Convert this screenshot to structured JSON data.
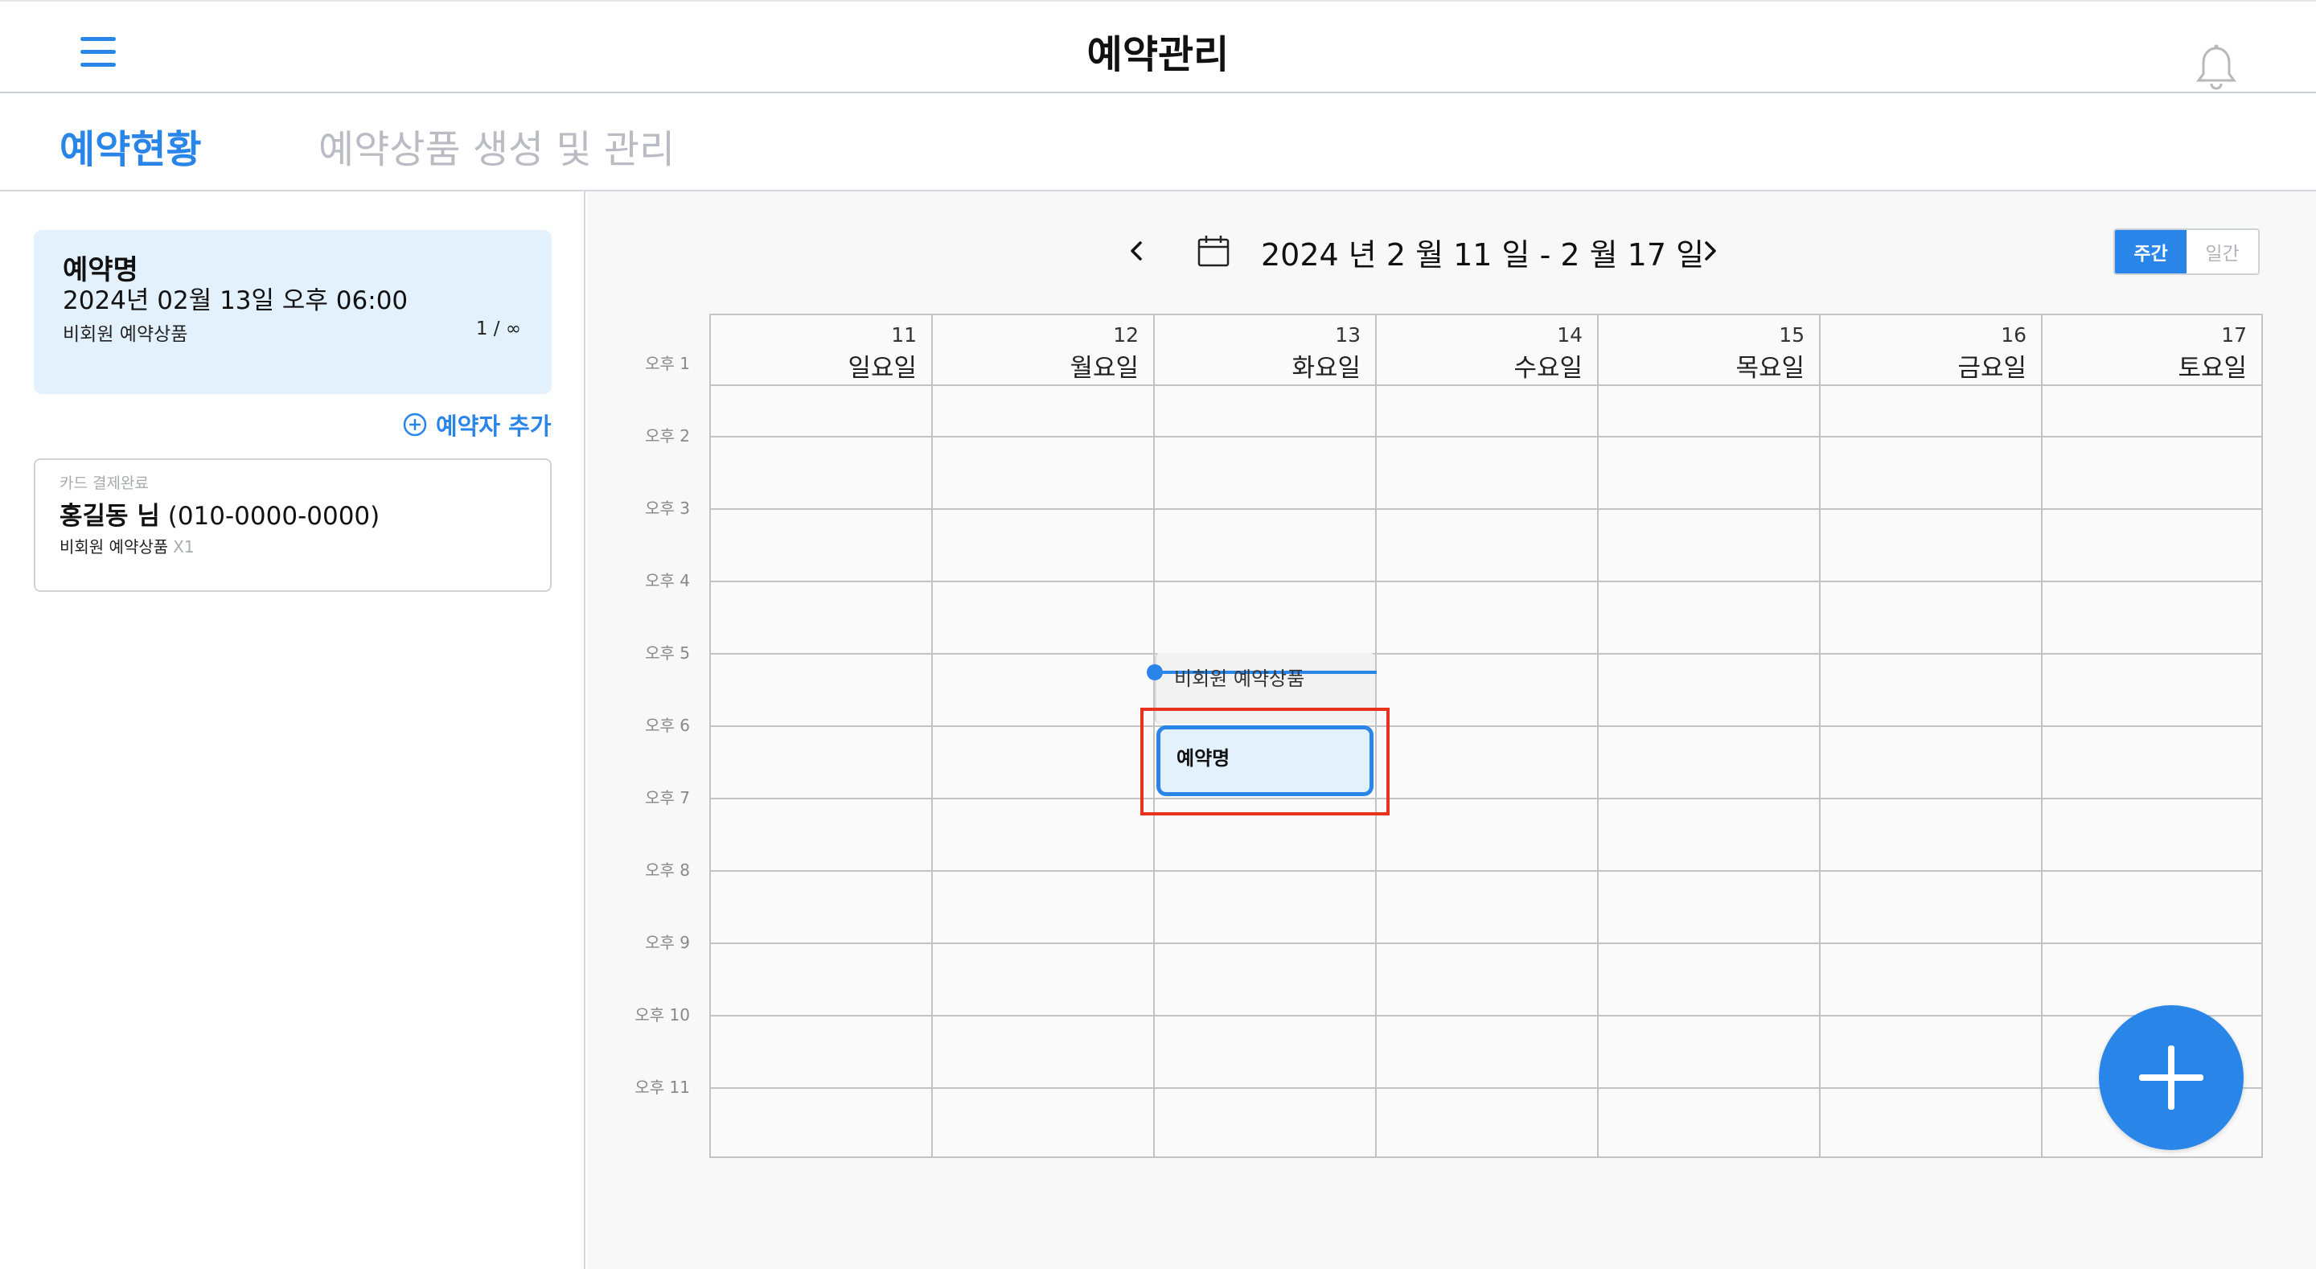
{
  "header": {
    "title": "예약관리",
    "menu_icon": "hamburger-menu-icon",
    "bell_icon": "bell-icon"
  },
  "tabs": [
    {
      "label": "예약현황",
      "active": true
    },
    {
      "label": "예약상품 생성 및 관리",
      "active": false
    }
  ],
  "sidebar": {
    "reservation": {
      "name": "예약명",
      "datetime": "2024년 02월 13일  오후 06:00",
      "product": "비회원 예약상품",
      "count": "1 / ∞"
    },
    "add_person_label": "예약자 추가",
    "person": {
      "payment_status": "카드 결제완료",
      "name": "홍길동 님",
      "phone": "(010-0000-0000)",
      "product": "비회원 예약상품",
      "qty": "X1"
    }
  },
  "calendar": {
    "range": "2024 년  2 월  11 일 - 2 월  17 일",
    "view_week": "주간",
    "view_day": "일간",
    "days": [
      {
        "num": "11",
        "name": "일요일"
      },
      {
        "num": "12",
        "name": "월요일"
      },
      {
        "num": "13",
        "name": "화요일"
      },
      {
        "num": "14",
        "name": "수요일"
      },
      {
        "num": "15",
        "name": "목요일"
      },
      {
        "num": "16",
        "name": "금요일"
      },
      {
        "num": "17",
        "name": "토요일"
      }
    ],
    "times": [
      "오후 1",
      "오후 2",
      "오후 3",
      "오후 4",
      "오후 5",
      "오후 6",
      "오후 7",
      "오후 8",
      "오후 9",
      "오후 10",
      "오후 11"
    ],
    "events": {
      "product_label": "비회원 예약상품",
      "reservation_label": "예약명"
    }
  },
  "colors": {
    "accent": "#2a85e8",
    "highlight": "#e8321e",
    "card_bg": "#e3f1fd"
  }
}
